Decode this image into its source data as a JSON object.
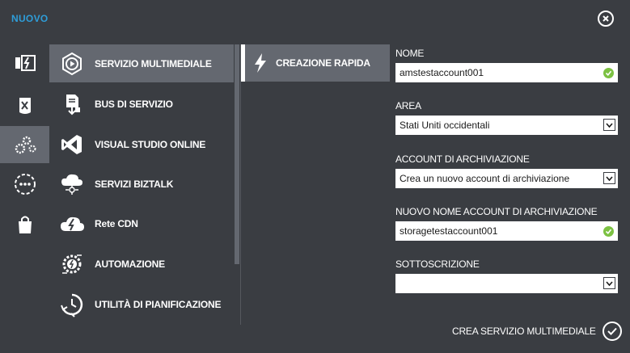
{
  "dialog": {
    "title": "NUOVO"
  },
  "rail": {
    "items": [
      {
        "icon": "data-services-icon",
        "active": false
      },
      {
        "icon": "app-services-icon",
        "active": false
      },
      {
        "icon": "gears-icon",
        "active": true
      },
      {
        "icon": "more-icon",
        "active": false
      },
      {
        "icon": "store-bag-icon",
        "active": false
      }
    ]
  },
  "services": {
    "items": [
      {
        "label": "SERVIZIO MULTIMEDIALE",
        "icon": "media-play-icon",
        "active": true
      },
      {
        "label": "BUS DI SERVIZIO",
        "icon": "service-bus-icon",
        "active": false
      },
      {
        "label": "VISUAL STUDIO ONLINE",
        "icon": "visual-studio-icon",
        "active": false
      },
      {
        "label": "SERVIZI BIZTALK",
        "icon": "biztalk-cloud-icon",
        "active": false
      },
      {
        "label": "Rete CDN",
        "icon": "cdn-cloud-icon",
        "active": false
      },
      {
        "label": "AUTOMAZIONE",
        "icon": "automation-gear-icon",
        "active": false
      },
      {
        "label": "UTILITÀ DI PIANIFICAZIONE",
        "icon": "scheduler-clock-icon",
        "active": false
      }
    ]
  },
  "modes": {
    "items": [
      {
        "label": "CREAZIONE RAPIDA",
        "icon": "lightning-icon",
        "active": true
      }
    ]
  },
  "form": {
    "name": {
      "label": "NOME",
      "value": "amstestaccount001",
      "valid": true
    },
    "region": {
      "label": "AREA",
      "value": "Stati Uniti occidentali"
    },
    "storage_account": {
      "label": "ACCOUNT DI ARCHIVIAZIONE",
      "value": "Crea un nuovo account di archiviazione"
    },
    "new_storage_name": {
      "label": "NUOVO NOME ACCOUNT DI ARCHIVIAZIONE",
      "value": "storagetestaccount001",
      "valid": true
    },
    "subscription": {
      "label": "SOTTOSCRIZIONE",
      "value": ""
    }
  },
  "footer": {
    "create_label": "CREA SERVIZIO MULTIMEDIALE"
  },
  "colors": {
    "background": "#3a3d42",
    "selected": "#646870",
    "title_accent": "#2e9dd8",
    "valid_green": "#7cc142"
  }
}
